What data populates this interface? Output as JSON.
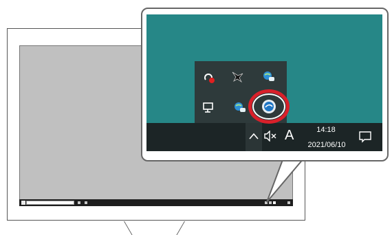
{
  "taskbar": {
    "time": "14:18",
    "date": "2021/06/10",
    "ime_indicator": "A"
  },
  "tray_flyout": {
    "icons": [
      "red-status-icon",
      "dark-bird-icon",
      "network-globe-icon",
      "monitor-settings-icon",
      "network-globe-icon-2",
      "app-logo-icon"
    ]
  },
  "icons": {
    "show-hidden-icons": "chevron-up-icon",
    "volume": "volume-muted-icon",
    "notifications": "action-center-icon"
  },
  "colors": {
    "desktop": "#268787",
    "taskbar": "#1c2526",
    "highlight": "#d9202a"
  }
}
